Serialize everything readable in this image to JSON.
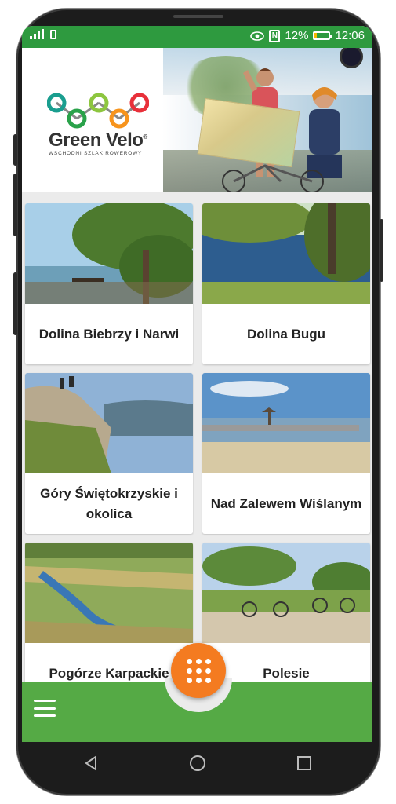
{
  "status_bar": {
    "battery_percent": "12%",
    "time": "12:06",
    "nfc_label": "N",
    "battery_level": 0.12
  },
  "header": {
    "logo_name": "Green Velo",
    "logo_registered": "®",
    "logo_tagline": "WSCHODNI SZLAK ROWEROWY"
  },
  "regions": [
    {
      "name": "Dolina Biebrzy i Narwi"
    },
    {
      "name": "Dolina Bugu"
    },
    {
      "name": "Góry Świętokrzyskie i okolica"
    },
    {
      "name": "Nad Zalewem Wiślanym"
    },
    {
      "name": "Pogórze Karpackie"
    },
    {
      "name": "Polesie"
    }
  ],
  "icons": {
    "menu": "hamburger-icon",
    "fab": "grid-dots-icon",
    "back": "back-triangle-icon",
    "home": "home-circle-icon",
    "recents": "recents-square-icon"
  },
  "colors": {
    "status_bar": "#2e9a3f",
    "bottom_bar": "#55aa45",
    "fab": "#f47b20"
  }
}
